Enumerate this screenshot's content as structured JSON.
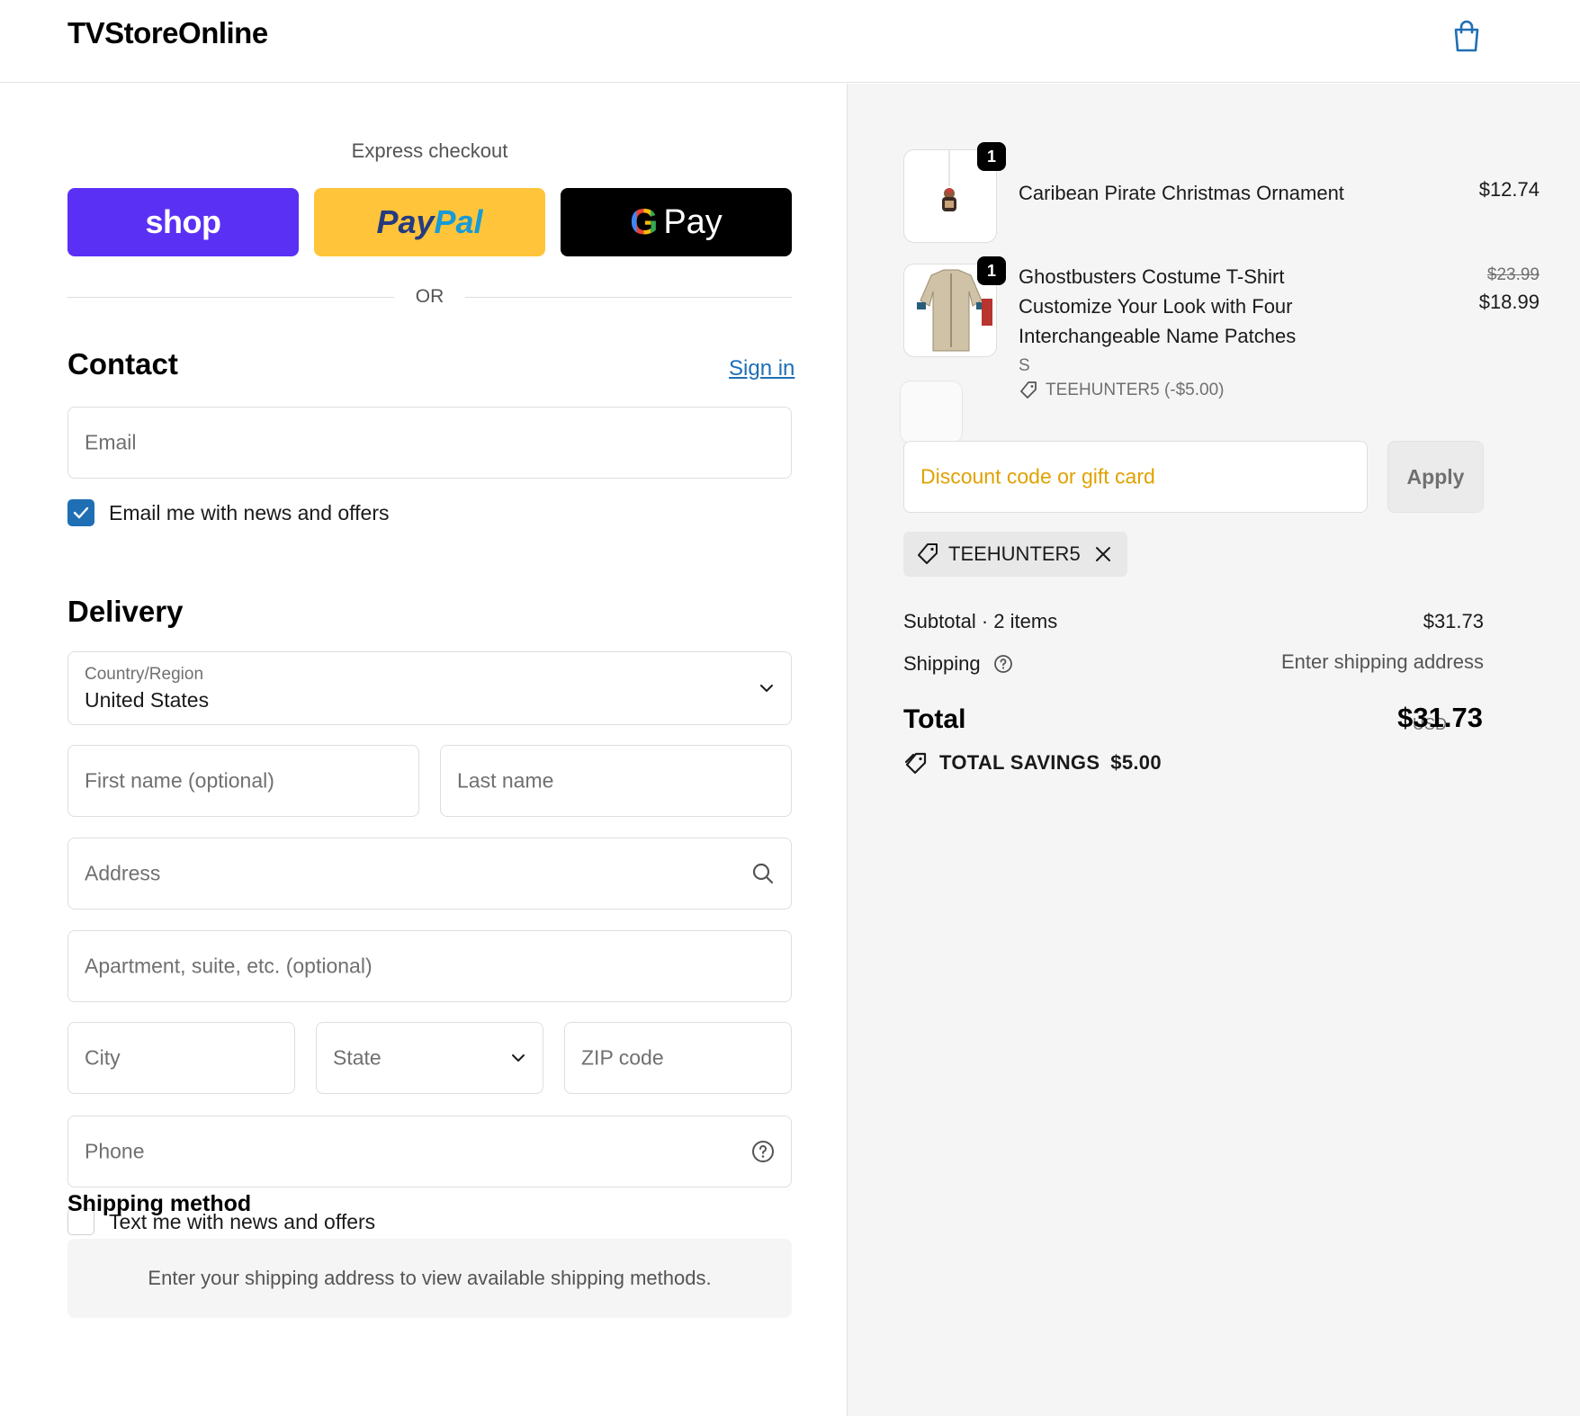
{
  "header": {
    "brand": "TVStoreOnline",
    "cart_icon": "shopping-bag-icon"
  },
  "express": {
    "title": "Express checkout",
    "shop_label": "shop",
    "paypal_part1": "Pay",
    "paypal_part2": "Pal",
    "gpay_g": "G",
    "gpay_label": "Pay",
    "or_text": "OR"
  },
  "contact": {
    "title": "Contact",
    "sign_in": "Sign in",
    "email_placeholder": "Email",
    "news_label": "Email me with news and offers",
    "news_checked": true
  },
  "delivery": {
    "title": "Delivery",
    "country_label": "Country/Region",
    "country_value": "United States",
    "first_name_placeholder": "First name (optional)",
    "last_name_placeholder": "Last name",
    "address_placeholder": "Address",
    "apartment_placeholder": "Apartment, suite, etc. (optional)",
    "city_placeholder": "City",
    "state_placeholder": "State",
    "zip_placeholder": "ZIP code",
    "phone_placeholder": "Phone",
    "text_label": "Text me with news and offers",
    "text_checked": false
  },
  "shipping_method": {
    "title": "Shipping method",
    "message": "Enter your shipping address to view available shipping methods."
  },
  "summary": {
    "items": [
      {
        "qty": "1",
        "name": "Caribean Pirate Christmas Ornament",
        "price": "$12.74"
      },
      {
        "qty": "1",
        "name_lines": [
          "Ghostbusters Costume T-Shirt",
          "Customize Your Look with Four",
          "Interchangeable Name Patches"
        ],
        "old_price": "$23.99",
        "price": "$18.99",
        "variant": "S",
        "discount": "TEEHUNTER5 (-$5.00)"
      }
    ],
    "discount_placeholder": "Discount code or gift card",
    "apply_label": "Apply",
    "applied_code": "TEEHUNTER5",
    "subtotal_label": "Subtotal · 2 items",
    "subtotal_value": "$31.73",
    "shipping_label": "Shipping",
    "shipping_value": "Enter shipping address",
    "total_label": "Total",
    "total_currency": "USD",
    "total_value": "$31.73",
    "savings_label": "TOTAL SAVINGS",
    "savings_value": "$5.00"
  },
  "colors": {
    "shop": "#5a31f4",
    "paypal": "#ffc439",
    "gpay": "#000000",
    "link": "#1f6fb5",
    "discount_placeholder": "#e0a200"
  }
}
